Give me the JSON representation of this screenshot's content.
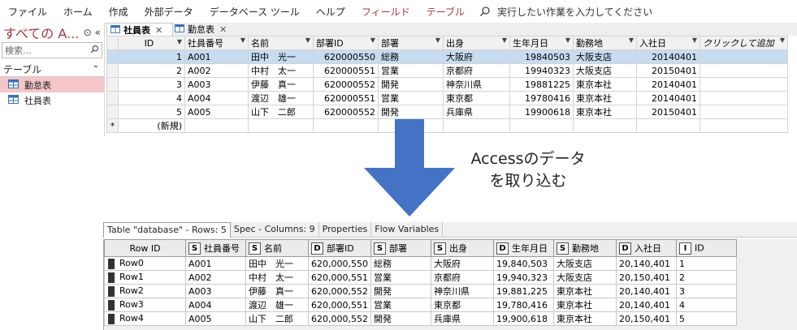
{
  "ribbon": {
    "tabs": [
      "ファイル",
      "ホーム",
      "作成",
      "外部データ",
      "データベース ツール",
      "ヘルプ",
      "フィールド",
      "テーブル"
    ],
    "search_label": "実行したい作業を入力してください"
  },
  "nav": {
    "title": "すべての A...",
    "search_placeholder": "検索...",
    "group": "テーブル",
    "items": [
      "勤怠表",
      "社員表"
    ]
  },
  "doc_tabs": [
    "社員表",
    "勤怠表"
  ],
  "access": {
    "columns": [
      "ID",
      "社員番号",
      "名前",
      "部署ID",
      "部署",
      "出身",
      "生年月日",
      "勤務地",
      "入社日",
      "クリックして追加"
    ],
    "rows": [
      [
        "1",
        "A001",
        "田中　光一",
        "620000550",
        "総務",
        "大阪府",
        "19840503",
        "大阪支店",
        "20140401"
      ],
      [
        "2",
        "A002",
        "中村　太一",
        "620000551",
        "営業",
        "京都府",
        "19940323",
        "大阪支店",
        "20150401"
      ],
      [
        "3",
        "A003",
        "伊藤　真一",
        "620000552",
        "開発",
        "神奈川県",
        "19881225",
        "東京本社",
        "20140401"
      ],
      [
        "4",
        "A004",
        "渡辺　雄一",
        "620000551",
        "営業",
        "東京都",
        "19780416",
        "東京本社",
        "20140401"
      ],
      [
        "5",
        "A005",
        "山下　二郎",
        "620000552",
        "開発",
        "兵庫県",
        "19900618",
        "東京本社",
        "20150401"
      ]
    ],
    "new_row_marker": "*",
    "new_row_label": "(新規)"
  },
  "annotation": {
    "line1": "Accessのデータ",
    "line2": "を取り込む"
  },
  "arrow_color": "#4472c4",
  "knime": {
    "tabs": [
      "Table \"database\" - Rows: 5",
      "Spec - Columns: 9",
      "Properties",
      "Flow Variables"
    ],
    "row_id_header": "Row ID",
    "columns": [
      {
        "type": "S",
        "name": "社員番号"
      },
      {
        "type": "S",
        "name": "名前"
      },
      {
        "type": "D",
        "name": "部署ID"
      },
      {
        "type": "S",
        "name": "部署"
      },
      {
        "type": "S",
        "name": "出身"
      },
      {
        "type": "D",
        "name": "生年月日"
      },
      {
        "type": "S",
        "name": "勤務地"
      },
      {
        "type": "D",
        "name": "入社日"
      },
      {
        "type": "I",
        "name": "ID"
      }
    ],
    "rows": [
      [
        "Row0",
        "A001",
        "田中　光一",
        "620,000,550",
        "総務",
        "大阪府",
        "19,840,503",
        "大阪支店",
        "20,140,401",
        "1"
      ],
      [
        "Row1",
        "A002",
        "中村　太一",
        "620,000,551",
        "営業",
        "京都府",
        "19,940,323",
        "大阪支店",
        "20,150,401",
        "2"
      ],
      [
        "Row2",
        "A003",
        "伊藤　真一",
        "620,000,552",
        "開発",
        "神奈川県",
        "19,881,225",
        "東京本社",
        "20,140,401",
        "3"
      ],
      [
        "Row3",
        "A004",
        "渡辺　雄一",
        "620,000,551",
        "営業",
        "東京都",
        "19,780,416",
        "東京本社",
        "20,140,401",
        "4"
      ],
      [
        "Row4",
        "A005",
        "山下　二郎",
        "620,000,552",
        "開発",
        "兵庫県",
        "19,900,618",
        "東京本社",
        "20,150,401",
        "5"
      ]
    ]
  }
}
